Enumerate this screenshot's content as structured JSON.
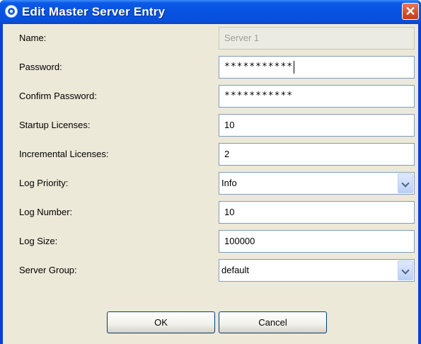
{
  "window": {
    "title": "Edit Master Server Entry",
    "close_glyph": "✕"
  },
  "form": {
    "name": {
      "label": "Name:",
      "value": "Server 1"
    },
    "password": {
      "label": "Password:",
      "value": "***********"
    },
    "confirm_password": {
      "label": "Confirm Password:",
      "value": "***********"
    },
    "startup_licenses": {
      "label": "Startup Licenses:",
      "value": "10"
    },
    "incremental_licenses": {
      "label": "Incremental Licenses:",
      "value": "2"
    },
    "log_priority": {
      "label": "Log Priority:",
      "value": "Info"
    },
    "log_number": {
      "label": "Log Number:",
      "value": "10"
    },
    "log_size": {
      "label": "Log Size:",
      "value": "100000"
    },
    "server_group": {
      "label": "Server Group:",
      "value": "default"
    }
  },
  "buttons": {
    "ok": "OK",
    "cancel": "Cancel"
  },
  "colors": {
    "titlebar": "#0752e0",
    "dialog_bg": "#ece9d8",
    "field_border": "#7f9db9",
    "close_button": "#d94d28"
  },
  "icons": {
    "app": "app-icon",
    "close": "close-icon",
    "dropdown": "chevron-down-icon"
  }
}
